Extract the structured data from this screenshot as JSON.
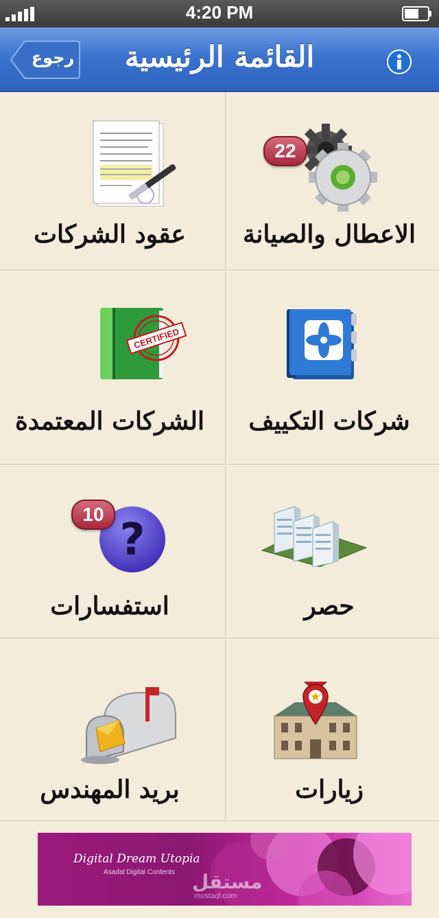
{
  "status_bar": {
    "time": "4:20 PM"
  },
  "nav": {
    "title": "القائمة الرئيسية",
    "back_label": "رجوع"
  },
  "tiles": [
    {
      "label": "الاعطال والصيانة",
      "badge": "22",
      "icon": "gears-icon"
    },
    {
      "label": "عقود الشركات",
      "icon": "contract-document-icon"
    },
    {
      "label": "شركات التكييف",
      "icon": "ac-fan-book-icon"
    },
    {
      "label": "الشركات المعتمدة",
      "icon": "certified-book-icon"
    },
    {
      "label": "حصر",
      "icon": "buildings-icon"
    },
    {
      "label": "استفسارات",
      "badge": "10",
      "icon": "question-icon"
    },
    {
      "label": "زيارات",
      "icon": "location-building-icon"
    },
    {
      "label": "بريد المهندس",
      "icon": "mailbox-icon"
    }
  ],
  "banner": {
    "title": "Digital Dream Utopia",
    "subtitle": "Asadal Digital Contents",
    "watermark": "مستقل",
    "watermark_url": "mostaql.com"
  }
}
